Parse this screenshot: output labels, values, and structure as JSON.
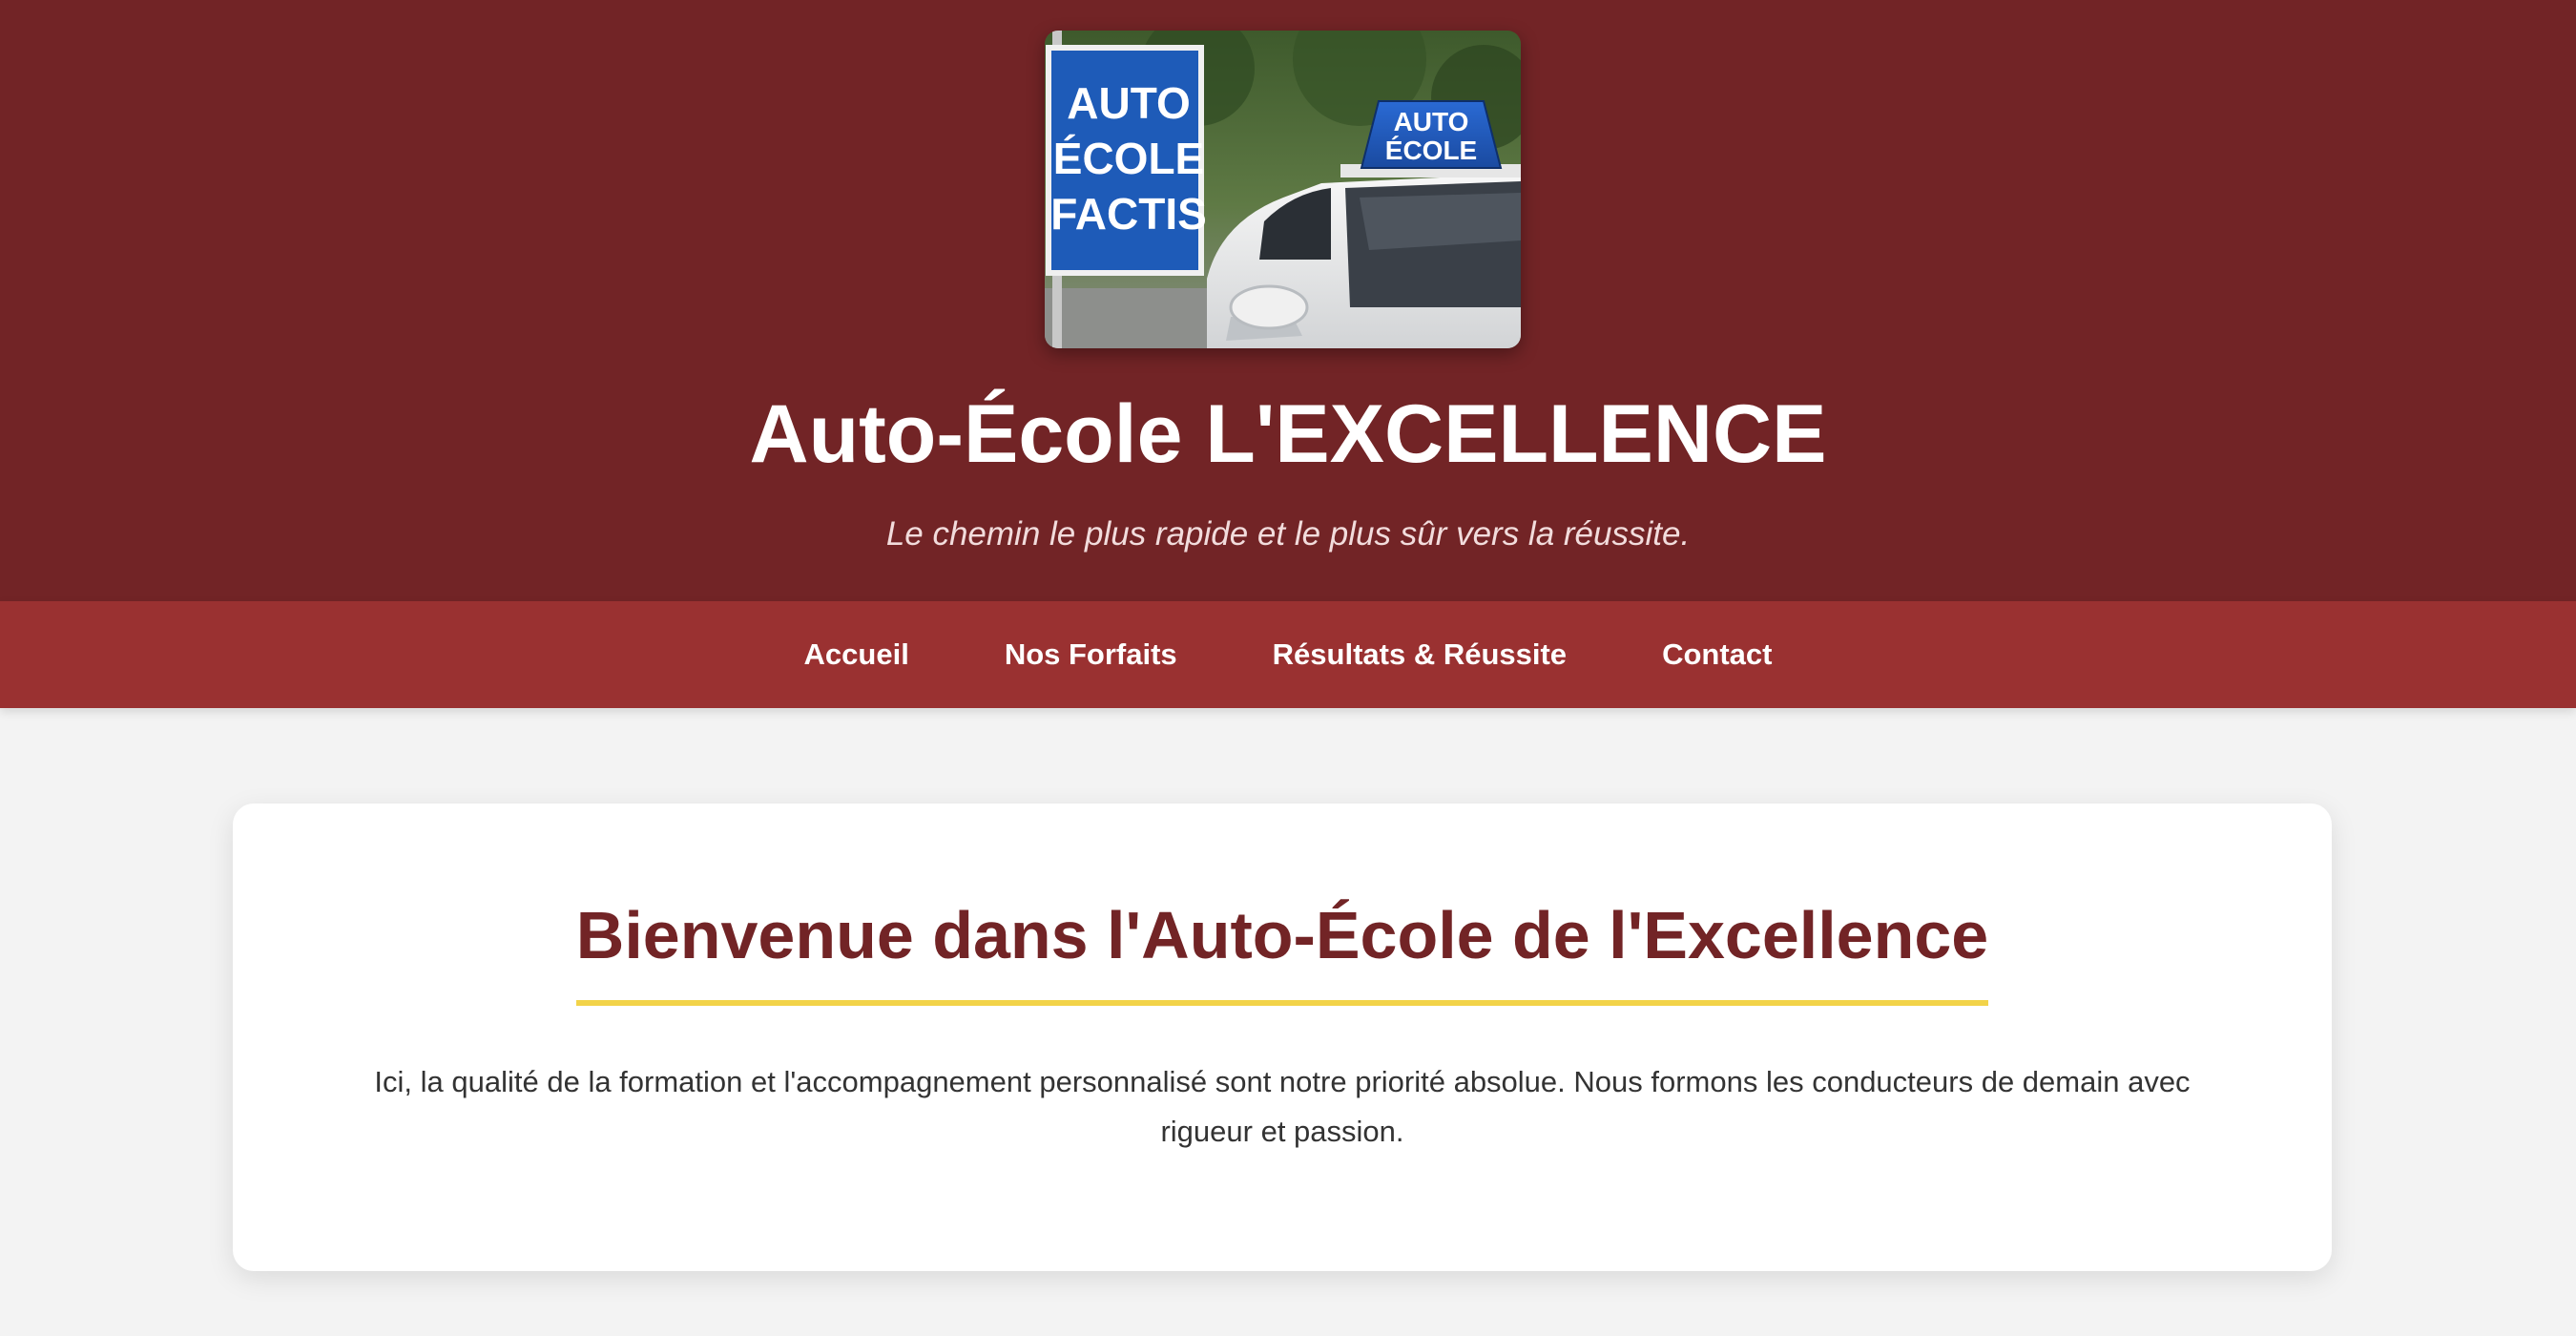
{
  "header": {
    "image": {
      "sign_lines": [
        "AUTO",
        "ÉCOLE",
        "FACTIS"
      ],
      "roof_sign_lines": [
        "AUTO",
        "ÉCOLE"
      ],
      "sign_color": "#1e5bb8"
    },
    "title": "Auto-École L'EXCELLENCE",
    "tagline": "Le chemin le plus rapide et le plus sûr vers la réussite."
  },
  "nav": {
    "items": [
      {
        "label": "Accueil"
      },
      {
        "label": "Nos Forfaits"
      },
      {
        "label": "Résultats & Réussite"
      },
      {
        "label": "Contact"
      }
    ]
  },
  "welcome": {
    "title": "Bienvenue dans l'Auto-École de l'Excellence",
    "text": "Ici, la qualité de la formation et l'accompagnement personnalisé sont notre priorité absolue. Nous formons les conducteurs de demain avec rigueur et passion."
  },
  "colors": {
    "header_bg": "#722426",
    "nav_bg": "#9a3131",
    "accent_underline": "#f2d349",
    "heading_color": "#722426"
  }
}
